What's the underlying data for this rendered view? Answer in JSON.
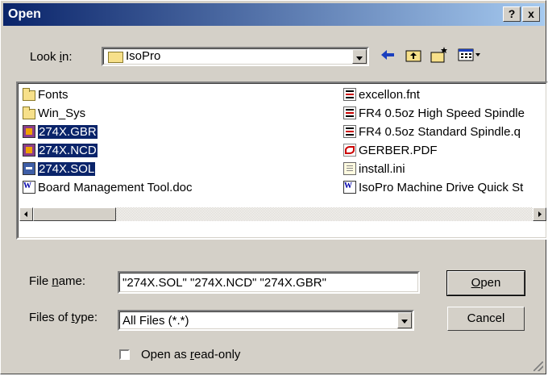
{
  "window": {
    "title": "Open"
  },
  "titlebar": {
    "help_label": "?",
    "close_label": "x"
  },
  "look_in": {
    "label_pre": "Look ",
    "label_accel": "i",
    "label_post": "n:",
    "value": "IsoPro"
  },
  "files": [
    {
      "name": "Fonts",
      "icon": "folder-icon",
      "selected": false
    },
    {
      "name": "Win_Sys",
      "icon": "folder-icon",
      "selected": false
    },
    {
      "name": "274X.GBR",
      "icon": "gbr-file-icon",
      "selected": true
    },
    {
      "name": "274X.NCD",
      "icon": "gbr-file-icon",
      "selected": true
    },
    {
      "name": "274X.SOL",
      "icon": "sol-file-icon",
      "selected": true
    },
    {
      "name": "Board Management Tool.doc",
      "icon": "word-doc-icon",
      "selected": false
    },
    {
      "name": "excellon.fnt",
      "icon": "generic-file-icon",
      "selected": false
    },
    {
      "name": "FR4 0.5oz High Speed Spindle",
      "icon": "generic-file-icon",
      "selected": false
    },
    {
      "name": "FR4 0.5oz Standard Spindle.q",
      "icon": "generic-file-icon",
      "selected": false
    },
    {
      "name": "GERBER.PDF",
      "icon": "pdf-icon",
      "selected": false
    },
    {
      "name": "install.ini",
      "icon": "ini-icon",
      "selected": false
    },
    {
      "name": "IsoPro Machine Drive Quick St",
      "icon": "word-doc-icon",
      "selected": false
    }
  ],
  "file_name": {
    "label_pre": "File ",
    "label_accel": "n",
    "label_post": "ame:",
    "value": "\"274X.SOL\" \"274X.NCD\" \"274X.GBR\""
  },
  "file_type": {
    "label_pre": "Files of ",
    "label_accel": "t",
    "label_post": "ype:",
    "value": "All Files (*.*)"
  },
  "buttons": {
    "open_accel": "O",
    "open_rest": "pen",
    "cancel": "Cancel"
  },
  "readonly": {
    "label_pre": "Open as ",
    "label_accel": "r",
    "label_post": "ead-only",
    "checked": false
  },
  "colors": {
    "title_start": "#0a246a",
    "title_end": "#a6caf0",
    "selection": "#0a246a",
    "face": "#d4d0c8"
  }
}
